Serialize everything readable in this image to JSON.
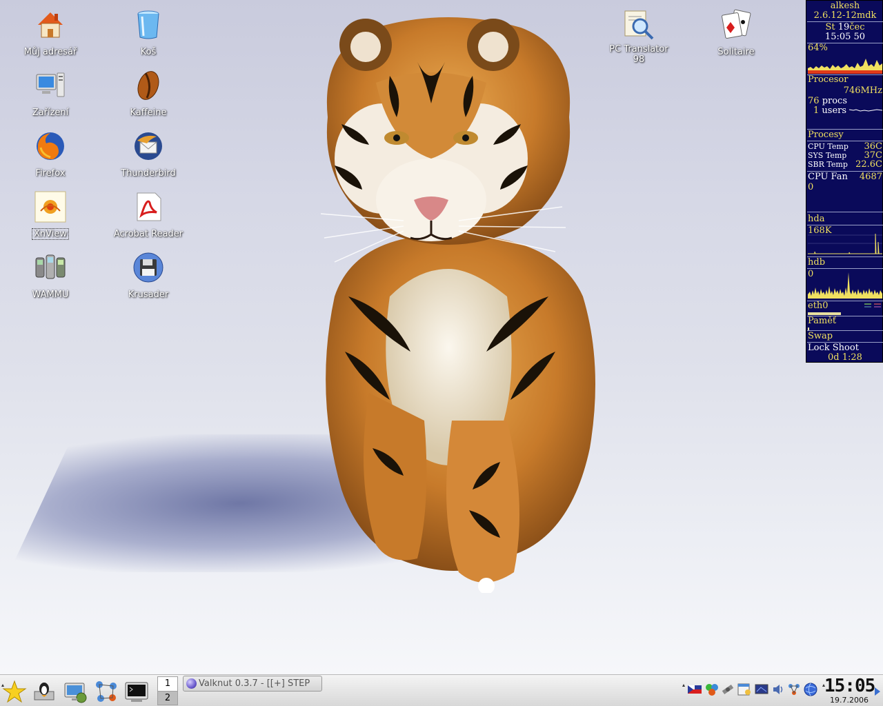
{
  "desktop": {
    "icons": [
      {
        "label": "Můj adresář",
        "icon": "home-folder-icon"
      },
      {
        "label": "Koš",
        "icon": "trash-icon"
      },
      {
        "label": "Zařízení",
        "icon": "computer-icon"
      },
      {
        "label": "Kaffeine",
        "icon": "coffee-bean-icon"
      },
      {
        "label": "Firefox",
        "icon": "firefox-icon"
      },
      {
        "label": "Thunderbird",
        "icon": "thunderbird-icon"
      },
      {
        "label": "XnView",
        "icon": "xnview-icon"
      },
      {
        "label": "Acrobat Reader",
        "icon": "acrobat-icon"
      },
      {
        "label": "WAMMU",
        "icon": "mobile-phones-icon"
      },
      {
        "label": "Krusader",
        "icon": "floppy-disk-icon"
      },
      {
        "label": "PC Translator 98",
        "icon": "dictionary-magnifier-icon"
      },
      {
        "label": "Solitaire",
        "icon": "playing-cards-icon"
      }
    ]
  },
  "monitor": {
    "host": "alkesh",
    "kernel": "2.6.12-12mdk",
    "date_day": "St",
    "date_num": "19",
    "date_month": "čec",
    "time": "15:05 50",
    "cpu_percent": "64%",
    "cpu_label": "Procesor",
    "cpu_freq": "746MHz",
    "procs_count": "76",
    "procs_label": "procs",
    "users_count": "1",
    "users_label": "users",
    "procs_section": "Procesy",
    "cpu_temp_label": "CPU Temp",
    "cpu_temp": "36C",
    "sys_temp_label": "SYS Temp",
    "sys_temp": "37C",
    "sbr_temp_label": "SBR Temp",
    "sbr_temp": "22.6C",
    "fan_label": "CPU Fan",
    "fan_value": "4687",
    "fan_zero": "0",
    "hda_label": "hda",
    "hda_value": "168K",
    "hdb_label": "hdb",
    "hdb_value": "0",
    "eth_label": "eth0",
    "mem_label": "Paměť",
    "swap_label": "Swap",
    "lock_label": "Lock",
    "shoot_label": "Shoot",
    "uptime": "0d  1:28"
  },
  "taskbar": {
    "pager": [
      "1",
      "2"
    ],
    "task_title": "Valknut 0.3.7 - [[+] STEP",
    "clock_time": "15:05",
    "clock_date": "19.7.2006"
  },
  "colors": {
    "monitor_bg": "#0a0a5a",
    "monitor_text": "#f0e060",
    "monitor_text_light": "#ffffff"
  }
}
